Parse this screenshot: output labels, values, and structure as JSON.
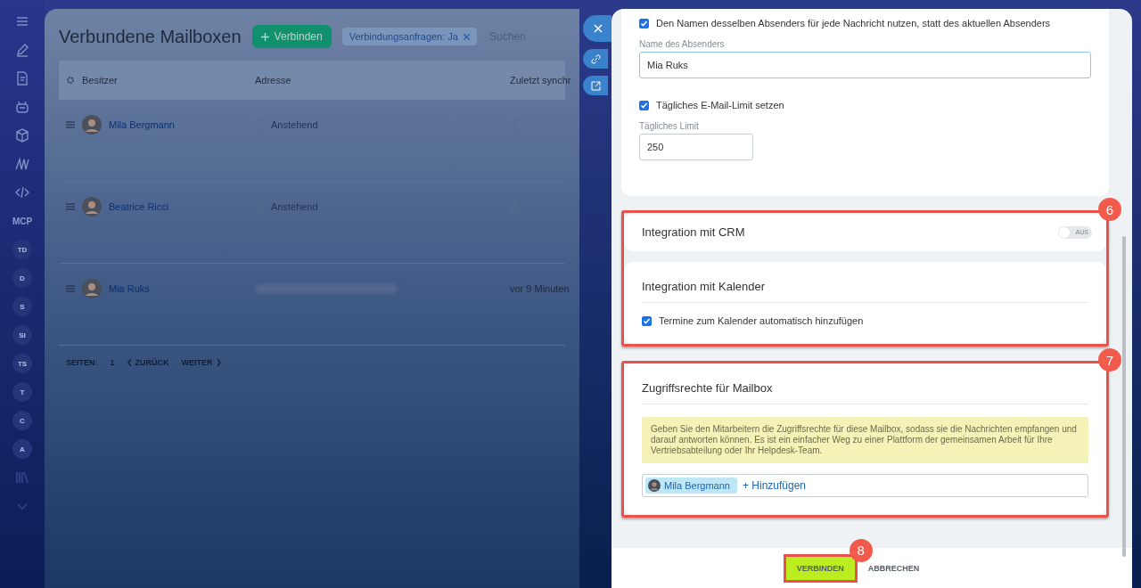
{
  "sidebar": {
    "items": [
      {
        "kind": "menu"
      },
      {
        "kind": "pen"
      },
      {
        "kind": "document"
      },
      {
        "kind": "robot"
      },
      {
        "kind": "box"
      },
      {
        "kind": "logo"
      },
      {
        "kind": "code"
      },
      {
        "kind": "text",
        "label": "MCP"
      },
      {
        "kind": "avatar",
        "label": "TD"
      },
      {
        "kind": "avatar",
        "label": "D"
      },
      {
        "kind": "avatar",
        "label": "S"
      },
      {
        "kind": "avatar",
        "label": "SI"
      },
      {
        "kind": "avatar",
        "label": "TS"
      },
      {
        "kind": "avatar",
        "label": "T"
      },
      {
        "kind": "avatar",
        "label": "C"
      },
      {
        "kind": "avatar",
        "label": "A"
      },
      {
        "kind": "library"
      },
      {
        "kind": "chevron"
      }
    ]
  },
  "page": {
    "title": "Verbundene Mailboxen",
    "connect_button": "Verbinden",
    "filter_chip": "Verbindungsanfragen: Ja",
    "search": {
      "placeholder": "Suchen"
    }
  },
  "table": {
    "columns": [
      "Besitzer",
      "Adresse",
      "Zuletzt synchr"
    ],
    "rows": [
      {
        "owner": "Mila Bergmann",
        "kind": "pending",
        "address": "Anstehend"
      },
      {
        "owner": "Beatrice Ricci",
        "kind": "pending",
        "address": "Anstehend"
      },
      {
        "owner": "Mia Ruks",
        "kind": "connected",
        "last_sync": "vor 9 Minuten"
      }
    ]
  },
  "pagination": {
    "label": "SEITEN:",
    "page": "1",
    "prev": "ZURÜCK",
    "next": "WEITER"
  },
  "slider": {
    "sender": {
      "checkbox": {
        "label": "Den Namen desselben Absenders für jede Nachricht nutzen, statt des aktuellen Absenders",
        "checked": true
      },
      "field_label": "Name des Absenders",
      "value": "Mia Ruks"
    },
    "limit": {
      "checkbox": {
        "label": "Tägliches E-Mail-Limit setzen",
        "checked": true
      },
      "field_label": "Tägliches Limit",
      "value": "250"
    },
    "crm": {
      "title": "Integration mit CRM",
      "toggle": {
        "label": "AUS",
        "on": false
      }
    },
    "calendar": {
      "title": "Integration mit Kalender",
      "checkbox": {
        "label": "Termine zum Kalender automatisch hinzufügen",
        "checked": true
      }
    },
    "access": {
      "title": "Zugriffsrechte für Mailbox",
      "notice": "Geben Sie den Mitarbeitern die Zugriffsrechte für diese Mailbox, sodass sie die Nachrichten empfangen und darauf antworten können. Es ist ein einfacher Weg zu einer Plattform der gemeinsamen Arbeit für Ihre Vertriebsabteilung oder Ihr Helpdesk-Team.",
      "members": [
        "Mila Bergmann"
      ],
      "add_link": "+ Hinzufügen"
    },
    "footer": {
      "primary": "VERBINDEN",
      "secondary": "ABBRECHEN"
    }
  },
  "callouts": [
    "6",
    "7",
    "8"
  ]
}
